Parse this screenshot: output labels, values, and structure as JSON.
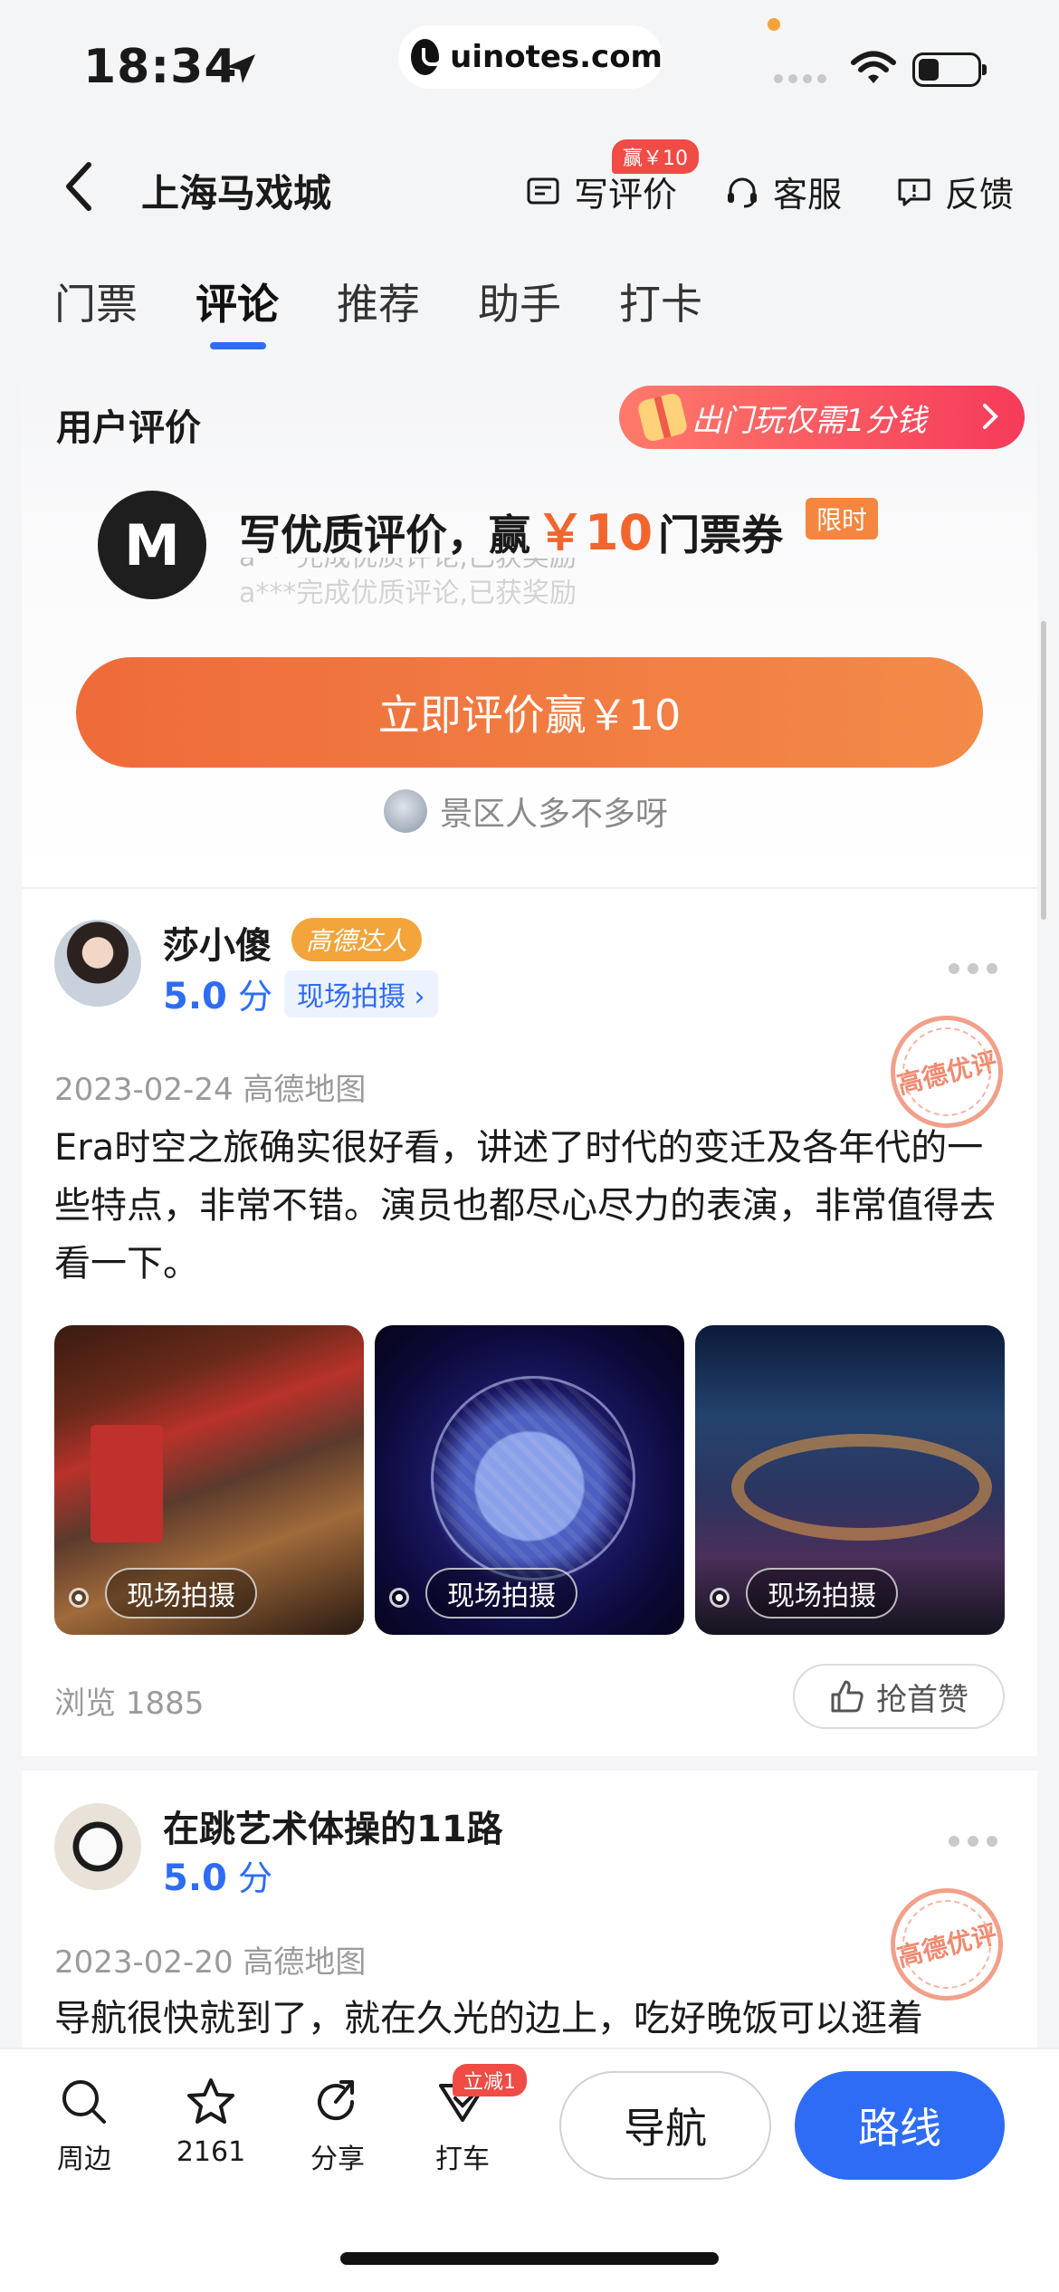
{
  "status_bar": {
    "time": "18:34",
    "url": "uinotes.com"
  },
  "header": {
    "title": "上海马戏城",
    "write_review": "写评价",
    "write_badge": "赢￥10",
    "service": "客服",
    "feedback": "反馈"
  },
  "tabs": [
    "门票",
    "评论",
    "推荐",
    "助手",
    "打卡"
  ],
  "active_tab": "评论",
  "section": {
    "title": "用户评价",
    "promo_pill": "出门玩仅需1分钱",
    "logo_letter": "M",
    "promo_head_prefix": "写优质评价，赢",
    "promo_amount": "￥10",
    "promo_head_suffix": "门票券",
    "limit_tag": "限时",
    "ticker": [
      "a***完成优质评论,已获奖励",
      "a***完成优质评论,已获奖励"
    ],
    "cta": "立即评价赢￥10",
    "hint": "景区人多不多呀"
  },
  "reviews": [
    {
      "name": "莎小傻",
      "badge": "高德达人",
      "score": "5.0",
      "score_unit": "分",
      "tag": "现场拍摄",
      "stamp": "高德优评",
      "date": "2023-02-24 高德地图",
      "text": "Era时空之旅确实很好看，讲述了时代的变迁及各年代的一些特点，非常不错。演员也都尽心尽力的表演，非常值得去看一下。",
      "photos": [
        "现场拍摄",
        "现场拍摄",
        "现场拍摄"
      ],
      "views": "浏览 1885",
      "like": "抢首赞"
    },
    {
      "name": "在跳艺术体操的11路",
      "score": "5.0",
      "score_unit": "分",
      "stamp": "高德优评",
      "date": "2023-02-20 高德地图",
      "text": "导航很快就到了，就在久光的边上，吃好晚饭可以逛着"
    }
  ],
  "bottom_bar": {
    "nearby": "周边",
    "favorites": "2161",
    "share": "分享",
    "taxi": "打车",
    "taxi_badge": "立减1",
    "navigate": "导航",
    "route": "路线"
  },
  "colors": {
    "accent": "#2f6cf5",
    "cta": "#ef6b3a",
    "badge": "#f04b45"
  }
}
